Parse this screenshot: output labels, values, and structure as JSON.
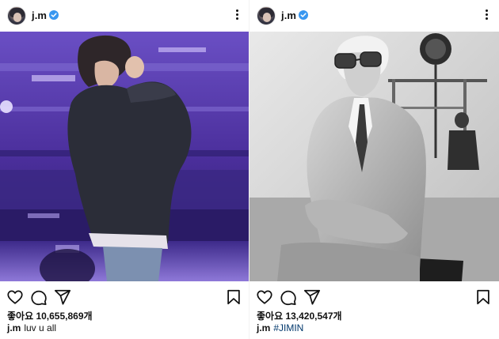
{
  "posts": [
    {
      "username": "j.m",
      "likes": "좋아요 10,655,869개",
      "caption_user": "j.m",
      "caption_text": "luv u all",
      "caption_hashtag": ""
    },
    {
      "username": "j.m",
      "likes": "좋아요 13,420,547개",
      "caption_user": "j.m",
      "caption_text": "",
      "caption_hashtag": "#JIMIN"
    }
  ],
  "icons": [
    "heart-icon",
    "comment-icon",
    "share-icon",
    "bookmark-icon",
    "verified-badge-icon",
    "more-options-icon"
  ],
  "colors": {
    "verified": "#3897f0",
    "hashtag": "#00376b",
    "text": "#111111",
    "stage_purple": "#5b3fb0"
  }
}
